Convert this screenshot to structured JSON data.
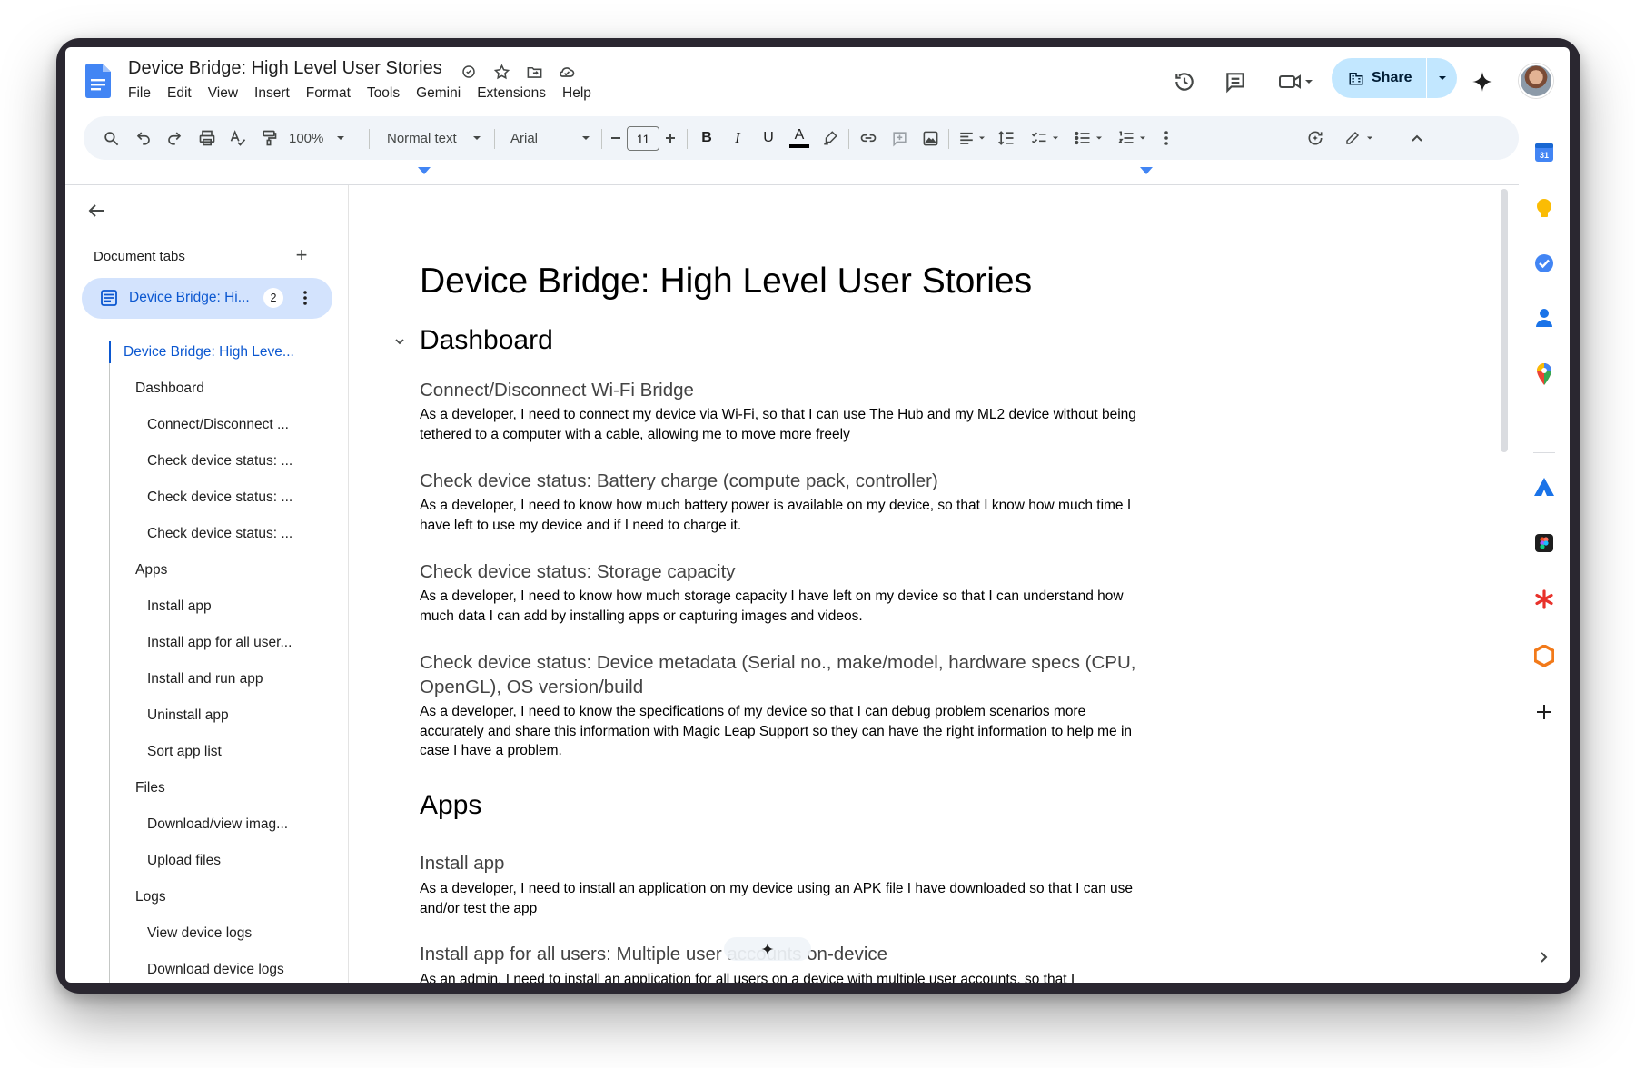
{
  "header": {
    "doc_title": "Device Bridge: High Level User Stories",
    "menu": [
      "File",
      "Edit",
      "View",
      "Insert",
      "Format",
      "Tools",
      "Gemini",
      "Extensions",
      "Help"
    ],
    "share_label": "Share"
  },
  "toolbar": {
    "zoom": "100%",
    "style": "Normal text",
    "font": "Arial",
    "font_size": "11",
    "bold": "B",
    "italic": "I",
    "underline": "U",
    "text_color": "A"
  },
  "sidebar": {
    "heading": "Document tabs",
    "active_tab": {
      "label": "Device Bridge: Hi...",
      "badge": "2"
    },
    "outline": [
      {
        "label": "Device Bridge: High Leve...",
        "level": 0,
        "current": true
      },
      {
        "label": "Dashboard",
        "level": 1
      },
      {
        "label": "Connect/Disconnect ...",
        "level": 2
      },
      {
        "label": "Check device status: ...",
        "level": 2
      },
      {
        "label": "Check device status: ...",
        "level": 2
      },
      {
        "label": "Check device status: ...",
        "level": 2
      },
      {
        "label": "Apps",
        "level": 1
      },
      {
        "label": "Install app",
        "level": 2
      },
      {
        "label": "Install app for all user...",
        "level": 2
      },
      {
        "label": "Install and run app",
        "level": 2
      },
      {
        "label": "Uninstall app",
        "level": 2
      },
      {
        "label": "Sort app list",
        "level": 2
      },
      {
        "label": "Files",
        "level": 1
      },
      {
        "label": "Download/view imag...",
        "level": 2
      },
      {
        "label": "Upload files",
        "level": 2
      },
      {
        "label": "Logs",
        "level": 1
      },
      {
        "label": "View device logs",
        "level": 2
      },
      {
        "label": "Download device logs",
        "level": 2
      }
    ]
  },
  "document": {
    "title": "Device Bridge: High Level User Stories",
    "h_dashboard": "Dashboard",
    "s1_heading": "Connect/Disconnect Wi-Fi Bridge",
    "s1_body": "As a developer, I need to connect my device via Wi-Fi, so that I can use The Hub and my ML2 device without being tethered to a computer with a cable, allowing me to move more freely",
    "s2_heading": "Check device status: Battery charge (compute pack, controller)",
    "s2_body": "As a developer, I need to know how much battery power is available on my device, so that I know how much time I have left to use my device and if I need to charge it.",
    "s3_heading": "Check device status: Storage capacity",
    "s3_body": "As a developer, I need to know how much storage capacity I have left on my device so that I can understand how much data I can add by installing apps or capturing images and videos.",
    "s4_heading": "Check device status: Device metadata (Serial no., make/model, hardware specs (CPU, OpenGL), OS version/build",
    "s4_body": "As a developer, I need to know the specifications of my device so that I can debug problem scenarios more accurately and share this information with Magic Leap Support so they can have the right information to help me in case I have a problem.",
    "h_apps": "Apps",
    "s5_heading": "Install app",
    "s5_body": "As a developer, I need to install an application on my device using an APK file I have downloaded so that I can use and/or test the app",
    "s6_heading": "Install app for all users: Multiple user accounts on-device",
    "s6_body": "As an admin, I need to install an application for all users on a device with multiple user accounts, so that I"
  },
  "colors": {
    "accent": "#0b57d0",
    "share_bg": "#c2e7ff",
    "active_tab_bg": "#d3e3fd",
    "toolbar_bg": "#f0f4f9"
  }
}
